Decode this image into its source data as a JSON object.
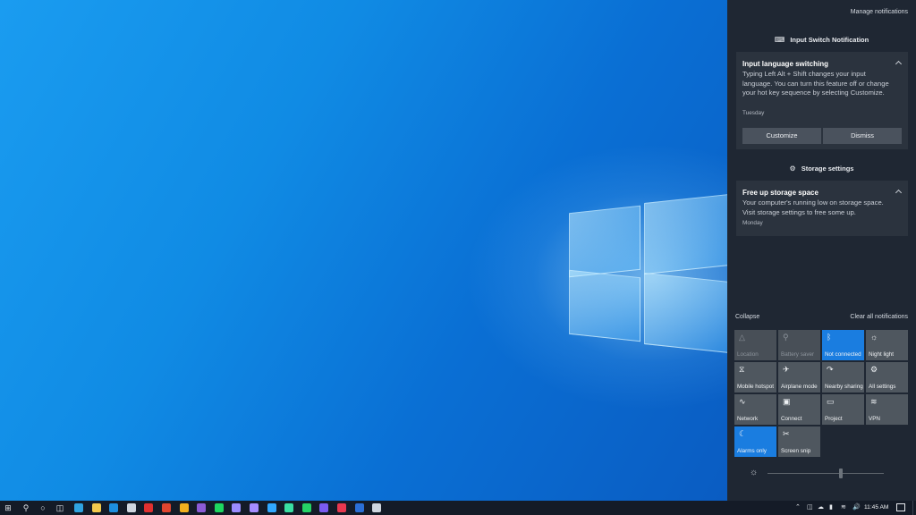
{
  "action_center": {
    "manage_notifications": "Manage notifications",
    "groups": [
      {
        "header": "Input Switch Notification",
        "icon": "keyboard-icon",
        "toast": {
          "title": "Input language switching",
          "body": "Typing Left Alt + Shift changes your input language. You can turn this feature off or change your hot key sequence by selecting Customize.",
          "time": "Tuesday",
          "buttons": [
            "Customize",
            "Dismiss"
          ]
        }
      },
      {
        "header": "Storage settings",
        "icon": "gear-icon",
        "toast": {
          "title": "Free up storage space",
          "body": "Your computer's running low on storage space. Visit storage settings to free some up.",
          "time": "Monday"
        }
      }
    ],
    "collapse": "Collapse",
    "clear_all": "Clear all notifications",
    "quick_actions": [
      {
        "label": "Location",
        "icon": "location-icon",
        "state": "disabled"
      },
      {
        "label": "Battery saver",
        "icon": "battery-saver-icon",
        "state": "disabled"
      },
      {
        "label": "Not connected",
        "icon": "bluetooth-icon",
        "state": "on"
      },
      {
        "label": "Night light",
        "icon": "night-light-icon",
        "state": "off"
      },
      {
        "label": "Mobile hotspot",
        "icon": "hotspot-icon",
        "state": "off"
      },
      {
        "label": "Airplane mode",
        "icon": "airplane-icon",
        "state": "off"
      },
      {
        "label": "Nearby sharing",
        "icon": "nearby-sharing-icon",
        "state": "off"
      },
      {
        "label": "All settings",
        "icon": "settings-icon",
        "state": "off"
      },
      {
        "label": "Network",
        "icon": "network-icon",
        "state": "off"
      },
      {
        "label": "Connect",
        "icon": "connect-icon",
        "state": "off"
      },
      {
        "label": "Project",
        "icon": "project-icon",
        "state": "off"
      },
      {
        "label": "VPN",
        "icon": "vpn-icon",
        "state": "off"
      },
      {
        "label": "Alarms only",
        "icon": "moon-icon",
        "state": "on"
      },
      {
        "label": "Screen snip",
        "icon": "screen-snip-icon",
        "state": "off"
      }
    ],
    "brightness_level": 0.63
  },
  "taskbar": {
    "clock": "11:45 AM",
    "pinned": [
      {
        "name": "edge-app-icon",
        "color": "#2fa3e0"
      },
      {
        "name": "file-explorer-app-icon",
        "color": "#f2c94c"
      },
      {
        "name": "mail-app-icon",
        "color": "#1d8fe0"
      },
      {
        "name": "steam-app-icon",
        "color": "#cfd6df"
      },
      {
        "name": "opera-app-icon",
        "color": "#e0302f"
      },
      {
        "name": "chrome-app-icon",
        "color": "#e0452f"
      },
      {
        "name": "yellow-app-icon",
        "color": "#f2b01e"
      },
      {
        "name": "visual-studio-app-icon",
        "color": "#8b5bd6"
      },
      {
        "name": "spotify-app-icon",
        "color": "#1ed760"
      },
      {
        "name": "premiere-app-icon",
        "color": "#9a8cff"
      },
      {
        "name": "after-effects-app-icon",
        "color": "#a58cff"
      },
      {
        "name": "photoshop-app-icon",
        "color": "#31a8ff"
      },
      {
        "name": "audition-app-icon",
        "color": "#3adfa2"
      },
      {
        "name": "whatsapp-app-icon",
        "color": "#25d366"
      },
      {
        "name": "purple-app-icon",
        "color": "#7a5bf0"
      },
      {
        "name": "red-app-icon",
        "color": "#e8384f"
      },
      {
        "name": "word-app-icon",
        "color": "#2b6fd6"
      },
      {
        "name": "snip-app-icon",
        "color": "#cfd6df"
      }
    ]
  }
}
